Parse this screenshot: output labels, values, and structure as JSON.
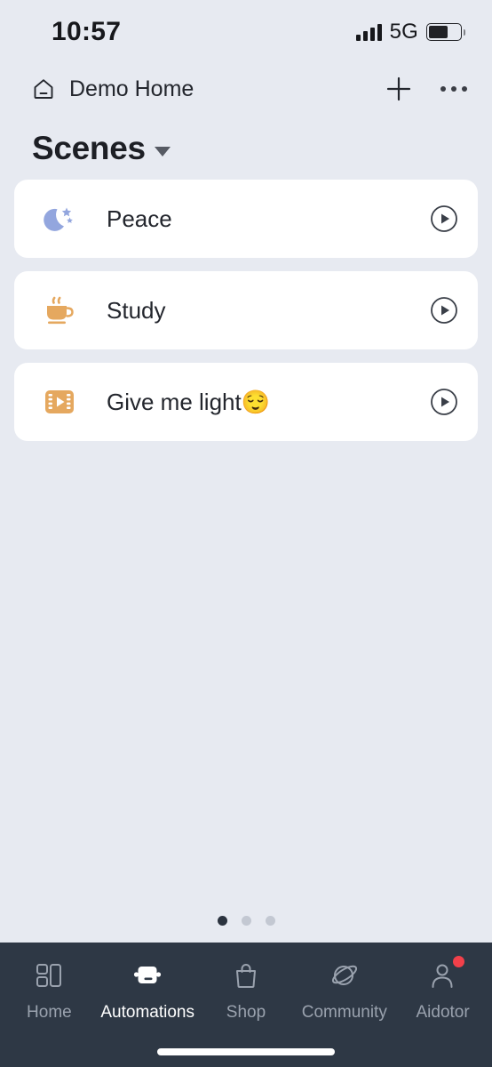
{
  "status_bar": {
    "time": "10:57",
    "network_label": "5G",
    "signal_icon": "signal-bars-icon",
    "battery_icon": "battery-icon",
    "battery_level_percent": 62
  },
  "header": {
    "home_icon": "house-icon",
    "home_name": "Demo Home",
    "add_label": "+",
    "add_icon": "plus-icon",
    "more_icon": "more-horizontal-icon"
  },
  "section": {
    "title": "Scenes",
    "dropdown_icon": "chevron-down-icon"
  },
  "scenes": [
    {
      "name": "Peace",
      "icon": "crescent-moon-stars-icon",
      "icon_color": "#93a6de",
      "action_icon": "play-circle-icon"
    },
    {
      "name": "Study",
      "icon": "coffee-cup-icon",
      "icon_color": "#e5a85f",
      "action_icon": "play-circle-icon"
    },
    {
      "name": "Give me light😌",
      "icon": "film-strip-play-icon",
      "icon_color": "#e5a85f",
      "action_icon": "play-circle-icon"
    }
  ],
  "pagination": {
    "total": 3,
    "active_index": 0
  },
  "tabbar": {
    "background": "#2e3845",
    "active_index": 1,
    "items": [
      {
        "label": "Home",
        "icon": "dashboard-grid-icon"
      },
      {
        "label": "Automations",
        "icon": "automation-device-icon"
      },
      {
        "label": "Shop",
        "icon": "shopping-bag-icon"
      },
      {
        "label": "Community",
        "icon": "planet-icon"
      },
      {
        "label": "Aidotor",
        "icon": "person-icon",
        "badge": true
      }
    ]
  }
}
